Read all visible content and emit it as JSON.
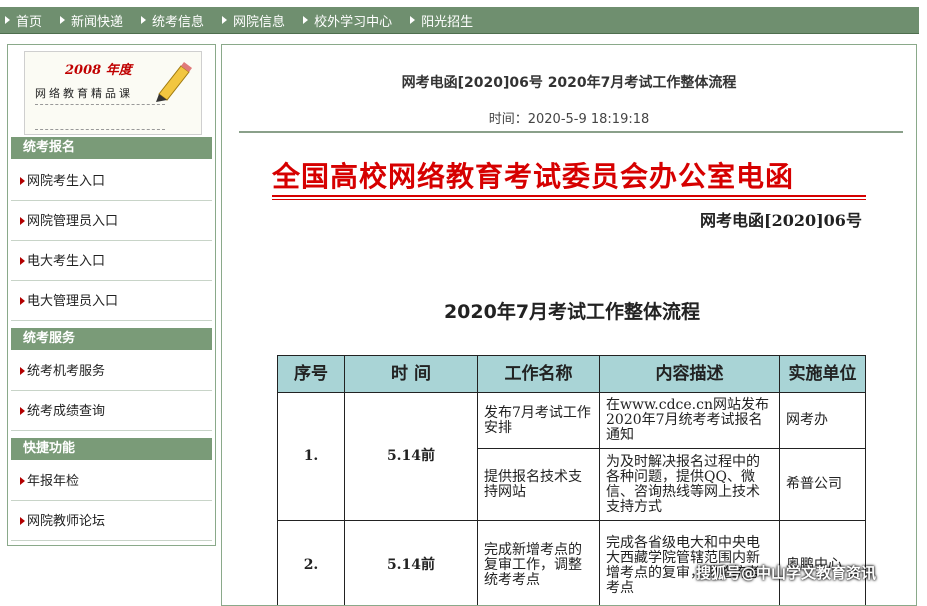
{
  "topnav": {
    "items": [
      "首页",
      "新闻快递",
      "统考信息",
      "网院信息",
      "校外学习中心",
      "阳光招生"
    ]
  },
  "banner": {
    "year": "2008 年度",
    "text": "网络教育精品课"
  },
  "sidebar": {
    "sections": [
      {
        "title": "统考报名",
        "items": [
          "网院考生入口",
          "网院管理员入口",
          "电大考生入口",
          "电大管理员入口"
        ]
      },
      {
        "title": "统考服务",
        "items": [
          "统考机考服务",
          "统考成绩查询"
        ]
      },
      {
        "title": "快捷功能",
        "items": [
          "年报年检",
          "网院教师论坛"
        ]
      }
    ]
  },
  "article": {
    "title": "网考电函[2020]06号 2020年7月考试工作整体流程",
    "time": "时间：2020-5-9 18:19:18",
    "red_header": "全国高校网络教育考试委员会办公室电函",
    "doc_number": "网考电函[2020]06号",
    "flow_title": "2020年7月考试工作整体流程"
  },
  "table": {
    "headers": [
      "序号",
      "时 间",
      "工作名称",
      "内容描述",
      "实施单位"
    ],
    "rows": [
      {
        "seq": "1.",
        "time": "5.14前",
        "name": "发布7月考试工作安排",
        "desc": "在www.cdce.cn网站发布2020年7月统考考试报名通知",
        "unit": "网考办"
      },
      {
        "seq": "",
        "time": "",
        "name": "提供报名技术支持网站",
        "desc": "为及时解决报名过程中的各种问题，提供QQ、微信、咨询热线等网上技术支持方式",
        "unit": "希普公司"
      },
      {
        "seq": "2.",
        "time": "5.14前",
        "name": "完成新增考点的复审工作，调整统考考点",
        "desc": "完成各省级电大和中央电大西藏学院管辖范围内新增考点的复审，调整统考考点",
        "unit": "奥鹏中心"
      }
    ]
  },
  "watermark": "搜狐号@中山学文教育资讯",
  "colors": {
    "nav_green": "#6f8f6f",
    "section_green": "#7a9b78",
    "header_red": "#d60000",
    "table_header": "#a9d4d6"
  }
}
